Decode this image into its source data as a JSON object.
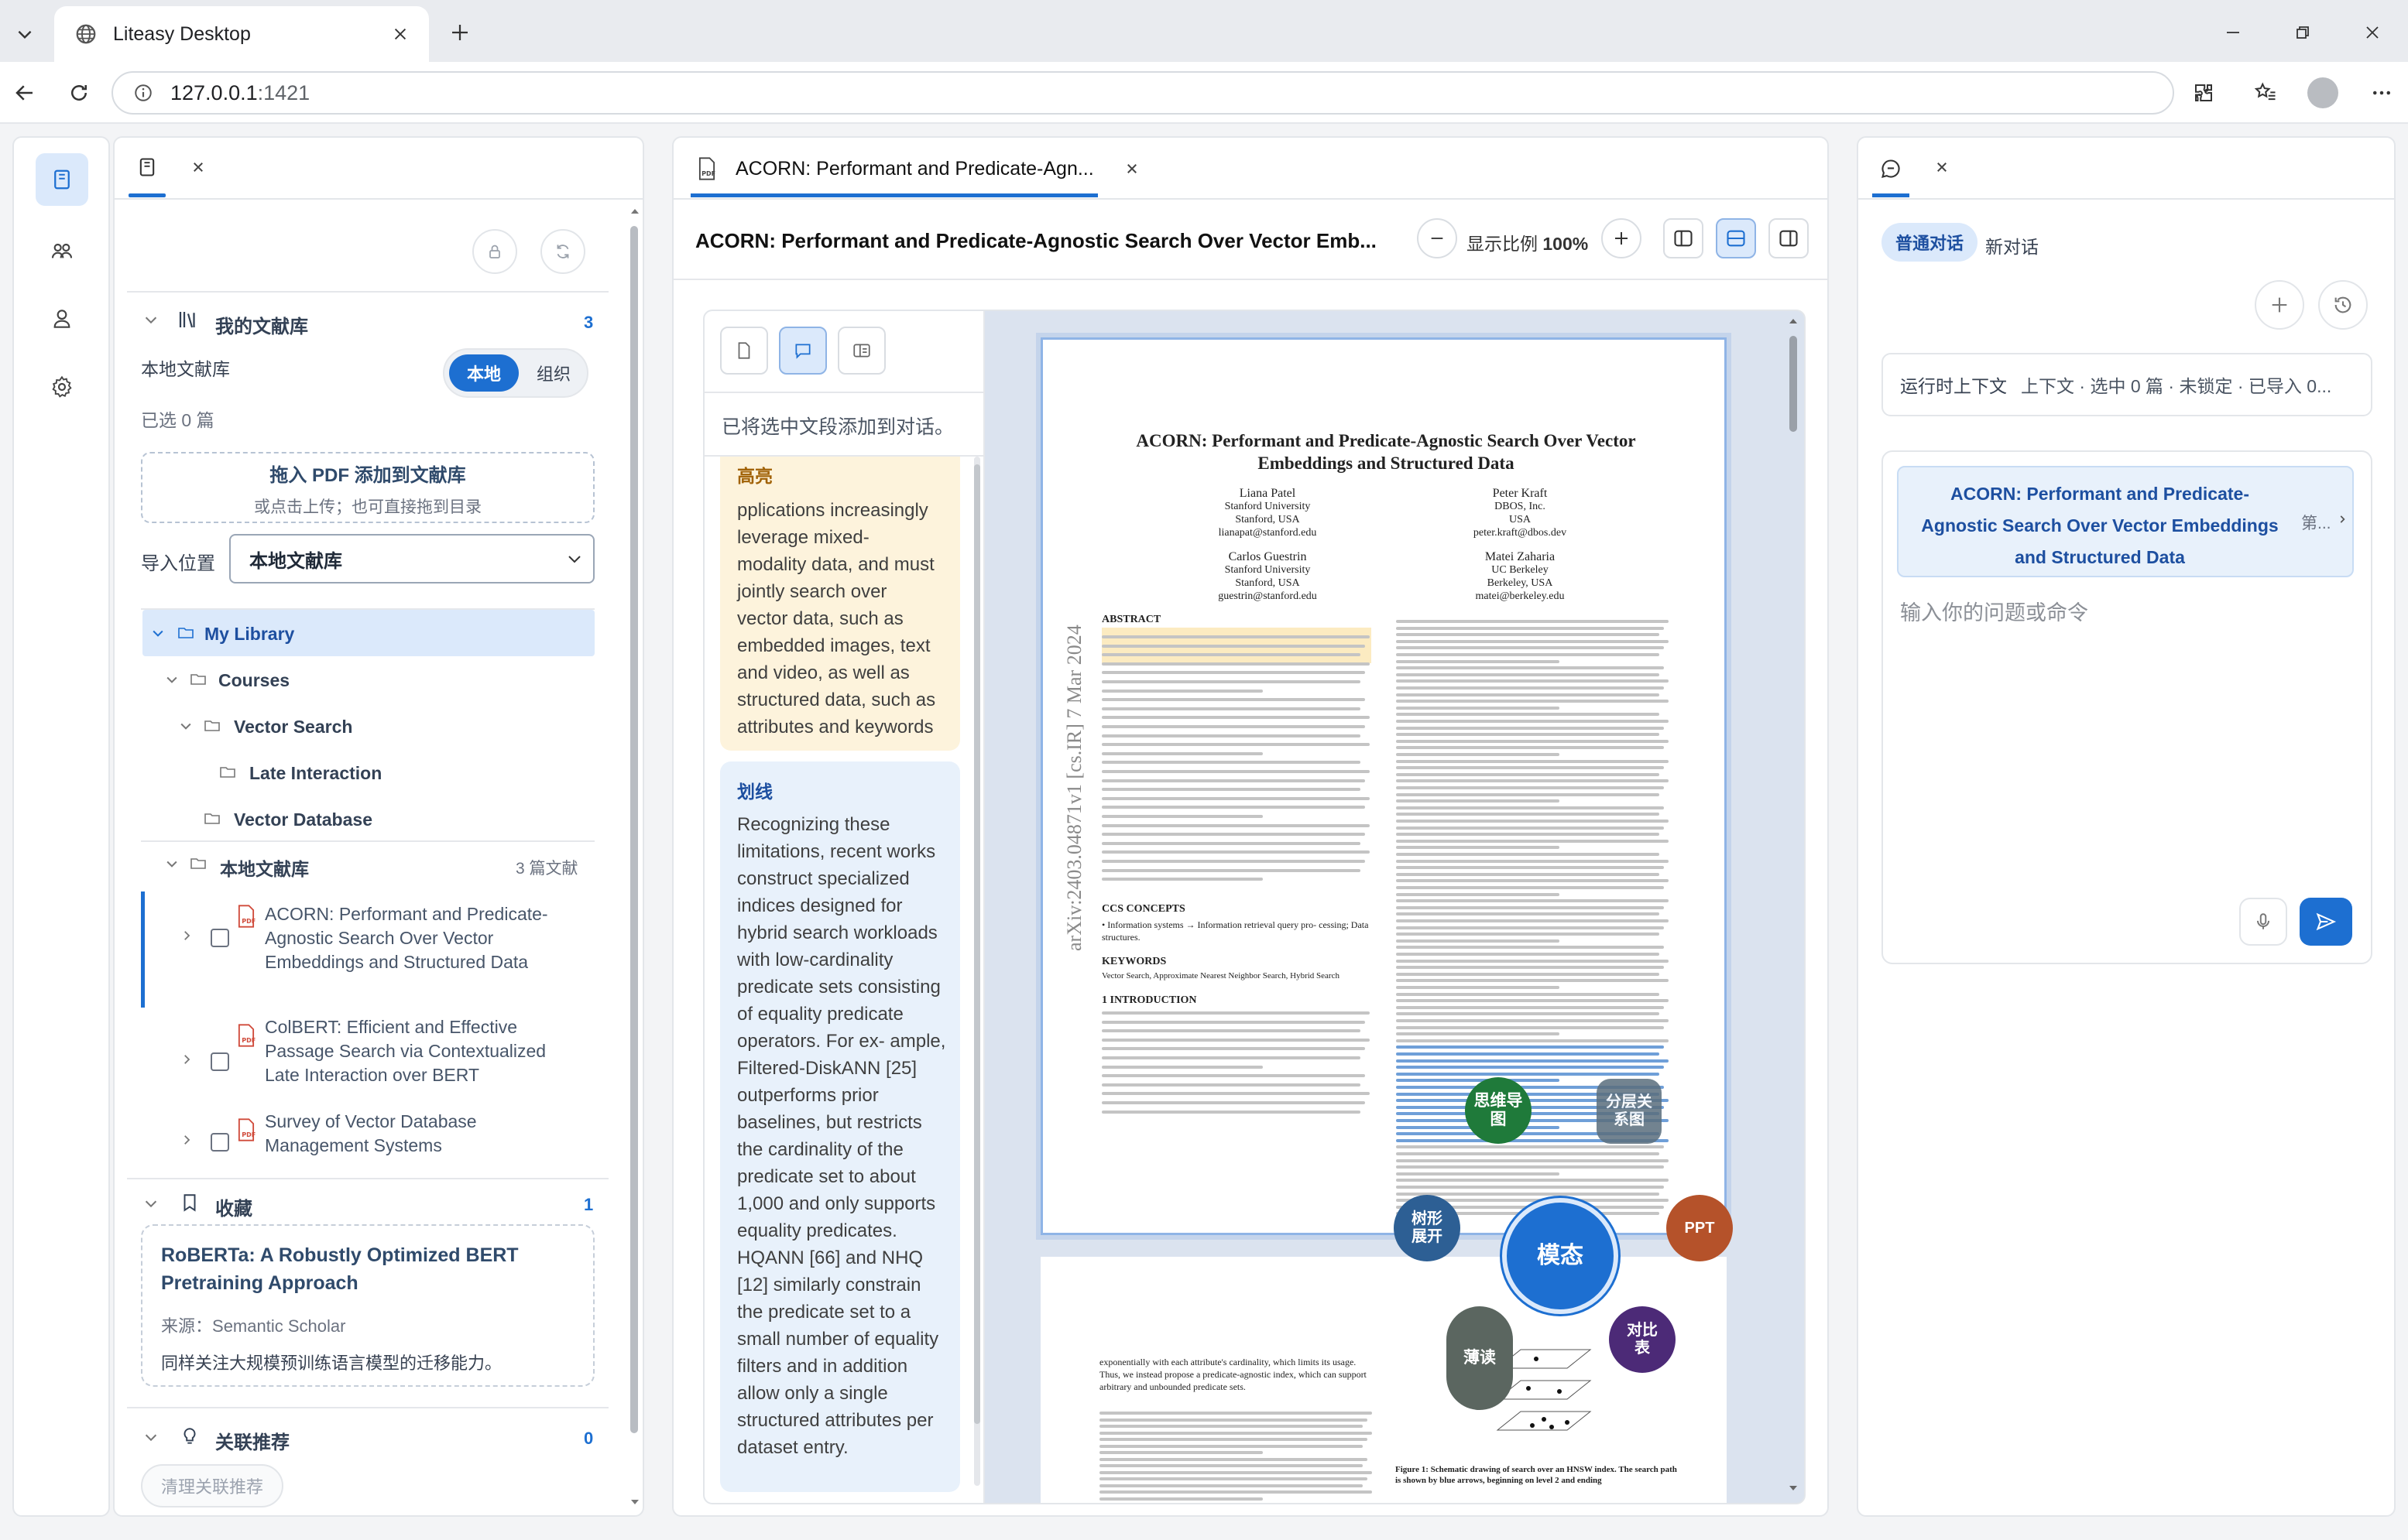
{
  "browser": {
    "tab_title": "Liteasy Desktop",
    "url_host": "127.0.0.1",
    "url_port": ":1421"
  },
  "library": {
    "section_title": "我的文献库",
    "section_count": "3",
    "local_label": "本地文献库",
    "toggle": [
      "本地",
      "组织"
    ],
    "selected_text": "已选 0 篇",
    "drop_title": "拖入 PDF 添加到文献库",
    "drop_hint": "或点击上传；也可直接拖到目录",
    "import_label": "导入位置",
    "import_value": "本地文献库",
    "tree": {
      "root": "My Library",
      "courses": "Courses",
      "vector_search": "Vector Search",
      "late_interaction": "Late Interaction",
      "vector_database": "Vector Database"
    },
    "local_lib": {
      "label": "本地文献库",
      "count": "3 篇文献"
    },
    "papers": [
      {
        "title_lines": [
          "ACORN: Performant and Predicate-",
          "Agnostic Search Over Vector",
          "Embeddings and Structured Data"
        ]
      },
      {
        "title_lines": [
          "ColBERT: Efficient and Effective",
          "Passage Search via Contextualized",
          "Late Interaction over BERT"
        ]
      },
      {
        "title_lines": [
          "Survey of Vector Database",
          "Management Systems"
        ]
      }
    ],
    "favorites": {
      "title": "收藏",
      "count": "1",
      "card_title_lines": [
        "RoBERTa: A Robustly Optimized BERT",
        "Pretraining Approach"
      ],
      "source_label": "来源：",
      "source_value": "Semantic Scholar",
      "note": "同样关注大规模预训练语言模型的迁移能力。"
    },
    "related": {
      "title": "关联推荐",
      "count": "0",
      "clear_button": "清理关联推荐"
    }
  },
  "reader": {
    "tab_title": "ACORN: Performant and Predicate-Agn...",
    "doc_title": "ACORN: Performant and Predicate-Agnostic Search Over Vector Emb...",
    "zoom_label": "显示比例",
    "zoom_value": "100%",
    "notes_banner": "已将选中文段添加到对话。",
    "highlight_card": {
      "label": "高亮",
      "lines": [
        "pplications increasingly",
        "leverage mixed-",
        "modality data, and must",
        "jointly search over",
        "vector data, such as",
        "embedded images, text",
        "and video, as well as",
        "structured data, such as",
        "attributes and keywords"
      ]
    },
    "underline_card": {
      "label": "划线",
      "lines": [
        "Recognizing these",
        "limitations, recent works",
        "construct specialized",
        "indices designed for",
        "hybrid search workloads",
        "with low-cardinality",
        "predicate sets consisting",
        "of equality predicate",
        "operators. For ex- ample,",
        "Filtered-DiskANN [25]",
        "outperforms prior",
        "baselines, but restricts",
        "the cardinality of the",
        "predicate set to about",
        "1,000 and only supports",
        "equality predicates.",
        "HQANN [66] and NHQ",
        "[12] similarly constrain",
        "the predicate set to a",
        "small number of equality",
        "filters and in addition",
        "allow only a single",
        "structured attributes per",
        "dataset entry."
      ]
    },
    "pdf": {
      "title_line1": "ACORN: Performant and Predicate-Agnostic Search Over Vector",
      "title_line2": "Embeddings and Structured Data",
      "arxiv_stamp": "arXiv:2403.04871v1  [cs.IR]  7 Mar 2024",
      "authors": [
        {
          "name": "Liana Patel",
          "aff": "Stanford University",
          "loc": "Stanford, USA",
          "email": "lianapat@stanford.edu"
        },
        {
          "name": "Peter Kraft",
          "aff": "DBOS, Inc.",
          "loc": "USA",
          "email": "peter.kraft@dbos.dev"
        },
        {
          "name": "Carlos Guestrin",
          "aff": "Stanford University",
          "loc": "Stanford, USA",
          "email": "guestrin@stanford.edu"
        },
        {
          "name": "Matei Zaharia",
          "aff": "UC Berkeley",
          "loc": "Berkeley, USA",
          "email": "matei@berkeley.edu"
        }
      ],
      "abstract_heading": "ABSTRACT",
      "ccs_heading": "CCS CONCEPTS",
      "ccs_text": "• Information systems → Information retrieval query pro- cessing; Data structures.",
      "keywords_heading": "KEYWORDS",
      "keywords_text": "Vector Search, Approximate Nearest Neighbor Search, Hybrid Search",
      "intro_heading": "1    INTRODUCTION",
      "page2_text": "exponentially with each attribute's cardinality, which limits its usage. Thus, we instead propose a predicate-agnostic index, which can support arbitrary and unbounded predicate sets.",
      "fig_caption": "Figure 1: Schematic drawing of search over an HNSW index. The search path is shown by blue arrows, beginning on level 2 and ending"
    },
    "mode_menu": {
      "center": "模态",
      "mindmap": "思维导图",
      "hierarchy": "分层关系图",
      "tree": "树形展开",
      "ppt": "PPT",
      "reading": "薄读",
      "compare": "对比表"
    }
  },
  "chat": {
    "tabs": [
      "普通对话",
      "新对话"
    ],
    "context_label": "运行时上下文",
    "context_value": "上下文 · 选中 0 篇 · 未锁定 · 已导入 0...",
    "ref_title_lines": [
      "ACORN: Performant and Predicate-",
      "Agnostic Search Over Vector Embeddings",
      "and Structured Data"
    ],
    "ref_tag": "第...",
    "input_placeholder": "输入你的问题或命令"
  },
  "colors": {
    "accent": "#1d6fd1",
    "highlight_bg": "#fdf3dc",
    "underline_bg": "#e8f1fb",
    "mindmap": "#1f7a3a",
    "hierarchy": "#5a6e7d",
    "tree": "#2d5f94",
    "ppt": "#b5522a",
    "reading": "#5b6660",
    "compare": "#4c2a77"
  }
}
